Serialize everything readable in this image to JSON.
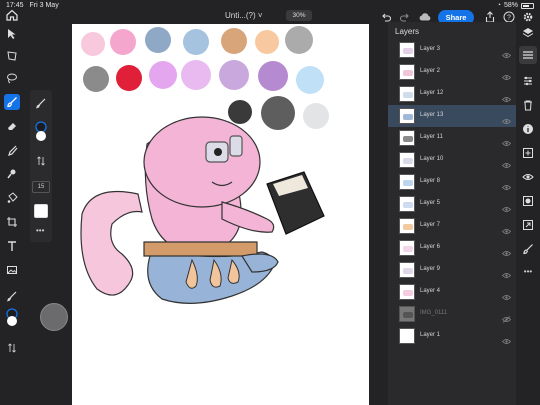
{
  "status": {
    "time": "17:45",
    "date": "Fri 3 May",
    "battery": "58%"
  },
  "toolbar": {
    "doc_title": "Unti...(?) ˅",
    "zoom": "30%",
    "share_label": "Share"
  },
  "brush": {
    "size_value": "15"
  },
  "layers_panel": {
    "title": "Layers",
    "items": [
      {
        "name": "Layer 3",
        "visible": true
      },
      {
        "name": "Layer 2",
        "visible": true
      },
      {
        "name": "Layer 12",
        "visible": true
      },
      {
        "name": "Layer 13",
        "visible": true,
        "selected": true
      },
      {
        "name": "Layer 11",
        "visible": true
      },
      {
        "name": "Layer 10",
        "visible": true
      },
      {
        "name": "Layer 8",
        "visible": true
      },
      {
        "name": "Layer 5",
        "visible": true
      },
      {
        "name": "Layer 7",
        "visible": true
      },
      {
        "name": "Layer 6",
        "visible": true
      },
      {
        "name": "Layer 9",
        "visible": true
      },
      {
        "name": "Layer 4",
        "visible": true
      },
      {
        "name": "IMG_0111",
        "visible": false
      },
      {
        "name": "Layer 1",
        "visible": true
      }
    ]
  },
  "palette_colors": [
    "#f8c8dc",
    "#f5a6cc",
    "#8fa8c6",
    "#a5c2df",
    "#d8a57b",
    "#f8c9a0",
    "#ababab",
    "#8b8b8b",
    "#e01f39",
    "#e4a6ee",
    "#e8baf0",
    "#c9a9dd",
    "#b58ad0",
    "#bfe0f7",
    "#3a3a3a",
    "#5e5e5e",
    "#e2e4e6"
  ],
  "accent": "#1473e6"
}
